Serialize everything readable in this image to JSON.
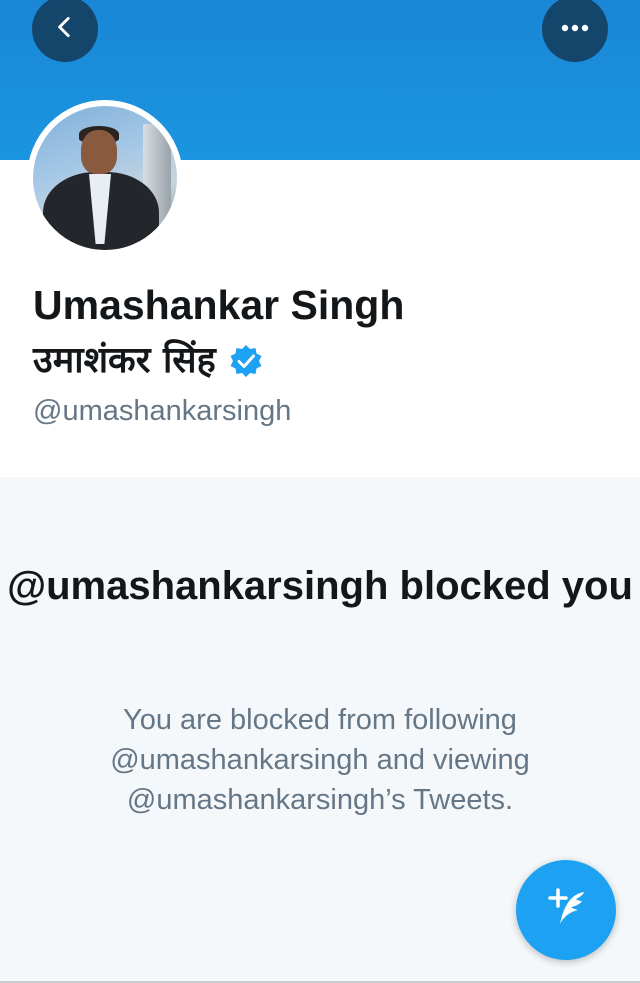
{
  "header": {
    "back_icon": "chevron-left-icon",
    "more_icon": "more-horizontal-icon",
    "banner_color": "#1b95e0"
  },
  "profile": {
    "name_en": "Umashankar Singh",
    "name_hi": "उमाशंकर सिंह",
    "verified_icon": "verified-badge-icon",
    "handle": "@umashankarsingh"
  },
  "blocked": {
    "title": "@umashankarsingh blocked you",
    "description": "You are blocked from following @umashankarsingh and viewing @umashankarsingh’s Tweets."
  },
  "fab": {
    "icon": "compose-tweet-icon",
    "color": "#1da1f2"
  }
}
